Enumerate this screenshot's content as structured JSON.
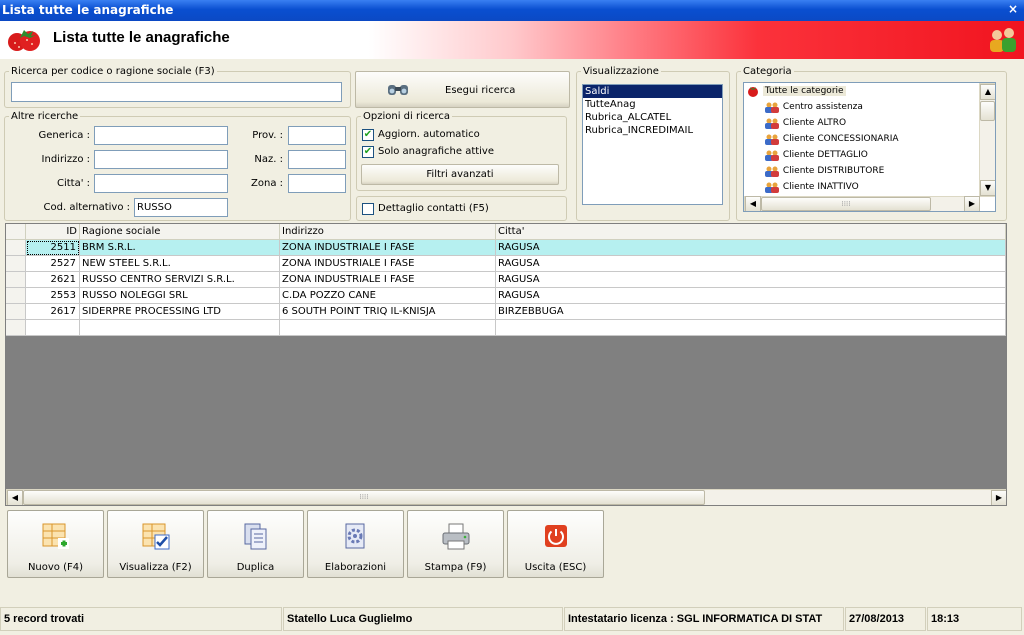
{
  "window": {
    "title": "Lista tutte le anagrafiche",
    "close": "×"
  },
  "header": {
    "title": "Lista tutte le anagrafiche"
  },
  "search": {
    "legend": "Ricerca per codice o ragione sociale (F3)",
    "value": "",
    "button": "Esegui ricerca"
  },
  "altre": {
    "legend": "Altre ricerche",
    "generica_label": "Generica :",
    "indirizzo_label": "Indirizzo :",
    "citta_label": "Citta' :",
    "cod_label": "Cod. alternativo :",
    "cod_value": "RUSSO",
    "prov_label": "Prov. :",
    "naz_label": "Naz. :",
    "zona_label": "Zona :"
  },
  "opzioni": {
    "legend": "Opzioni di ricerca",
    "aggiorn_label": "Aggiorn. automatico",
    "aggiorn_checked": true,
    "solo_label": "Solo anagrafiche attive",
    "solo_checked": true,
    "filtri": "Filtri avanzati",
    "dettaglio_label": "Dettaglio contatti (F5)",
    "dettaglio_checked": false
  },
  "visualizzazione": {
    "legend": "Visualizzazione",
    "items": [
      "Saldi",
      "TutteAnag",
      "Rubrica_ALCATEL",
      "Rubrica_INCREDIMAIL"
    ],
    "selected": "Saldi"
  },
  "categoria": {
    "legend": "Categoria",
    "root": "Tutte le categorie",
    "items": [
      "Centro assistenza",
      "Cliente ALTRO",
      "Cliente CONCESSIONARIA",
      "Cliente DETTAGLIO",
      "Cliente DISTRIBUTORE",
      "Cliente INATTIVO"
    ]
  },
  "table": {
    "columns": [
      "ID",
      "Ragione sociale",
      "Indirizzo",
      "Citta'"
    ],
    "rows": [
      {
        "id": "2511",
        "ragione": "BRM S.R.L.",
        "indirizzo": "ZONA INDUSTRIALE I FASE",
        "citta": "RAGUSA"
      },
      {
        "id": "2527",
        "ragione": "NEW STEEL S.R.L.",
        "indirizzo": "ZONA INDUSTRIALE I FASE",
        "citta": "RAGUSA"
      },
      {
        "id": "2621",
        "ragione": "RUSSO CENTRO SERVIZI S.R.L.",
        "indirizzo": "ZONA INDUSTRIALE I FASE",
        "citta": "RAGUSA"
      },
      {
        "id": "2553",
        "ragione": "RUSSO NOLEGGI SRL",
        "indirizzo": "C.DA POZZO CANE",
        "citta": "RAGUSA"
      },
      {
        "id": "2617",
        "ragione": "SIDERPRE PROCESSING LTD",
        "indirizzo": "6 SOUTH POINT TRIQ IL-KNISJA",
        "citta": "BIRZEBBUGA"
      }
    ]
  },
  "toolbar": {
    "nuovo": "Nuovo (F4)",
    "visualizza": "Visualizza (F2)",
    "duplica": "Duplica",
    "elaborazioni": "Elaborazioni",
    "stampa": "Stampa (F9)",
    "uscita": "Uscita (ESC)"
  },
  "statusbar": {
    "records": "5 record trovati",
    "user": "Statello Luca Guglielmo",
    "license": "Intestatario licenza : SGL  INFORMATICA DI STAT",
    "date": "27/08/2013",
    "time": "18:13"
  },
  "icons": {
    "strawberry": "strawberry-icon",
    "people": "people-icon",
    "binoculars": "binoculars-icon",
    "category": "people-category-icon"
  }
}
